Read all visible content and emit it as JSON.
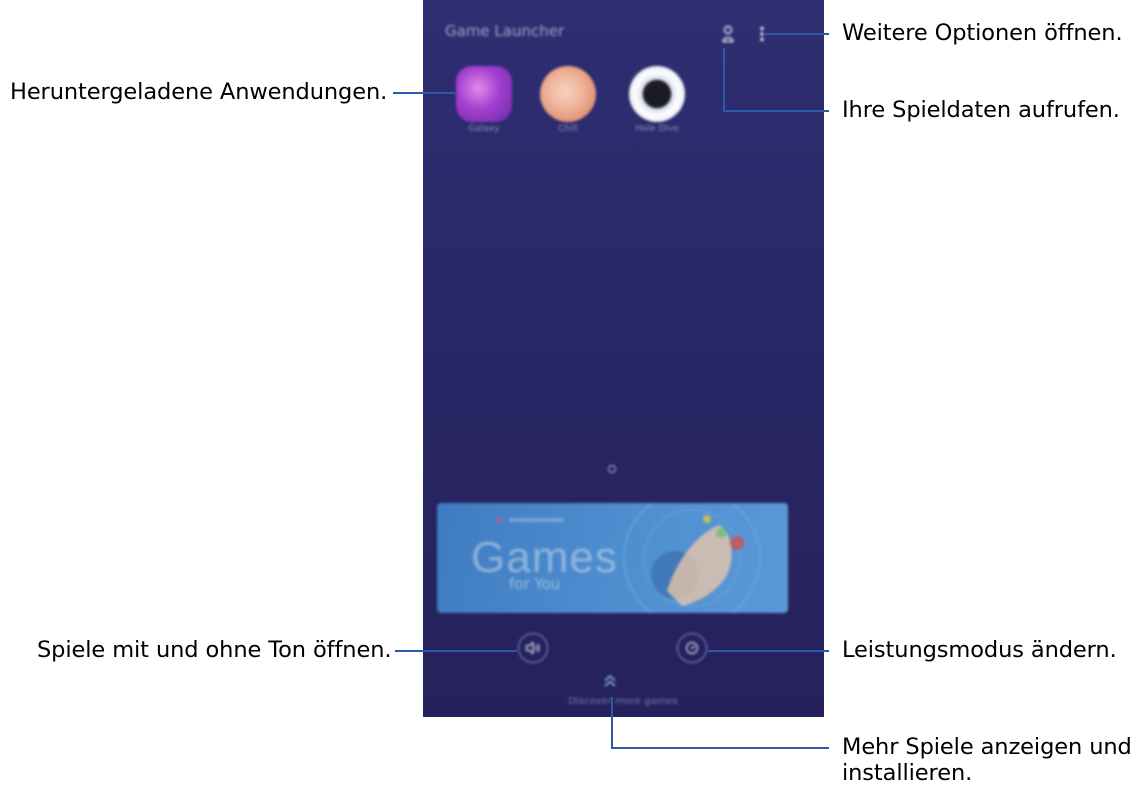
{
  "phone": {
    "app_title": "Game Launcher",
    "apps": [
      {
        "label": "Galaxy",
        "icon": "galaxy-game-icon"
      },
      {
        "label": "Chill",
        "icon": "chill-game-icon"
      },
      {
        "label": "Hole Dive",
        "icon": "hole-dive-game-icon"
      }
    ],
    "banner": {
      "title": "Games",
      "subtitle": "for You"
    },
    "discover_label": "Discover more games",
    "icons": {
      "profile": "profile-icon",
      "more": "more-options-icon",
      "sound": "speaker-icon",
      "performance": "performance-mode-icon",
      "discover": "chevron-up-icon"
    }
  },
  "callouts": {
    "downloaded_apps": "Heruntergeladene Anwendungen.",
    "more_options": "Weitere Optionen öffnen.",
    "game_data": "Ihre Spieldaten aufrufen.",
    "sound": "Spiele mit und ohne Ton öffnen.",
    "performance": "Leistungsmodus ändern.",
    "discover_line1": "Mehr Spiele anzeigen und",
    "discover_line2": "installieren."
  },
  "colors": {
    "phone_background": "#2a286a",
    "callout_line": "#2b5aa8",
    "banner": "#4a89cc"
  }
}
